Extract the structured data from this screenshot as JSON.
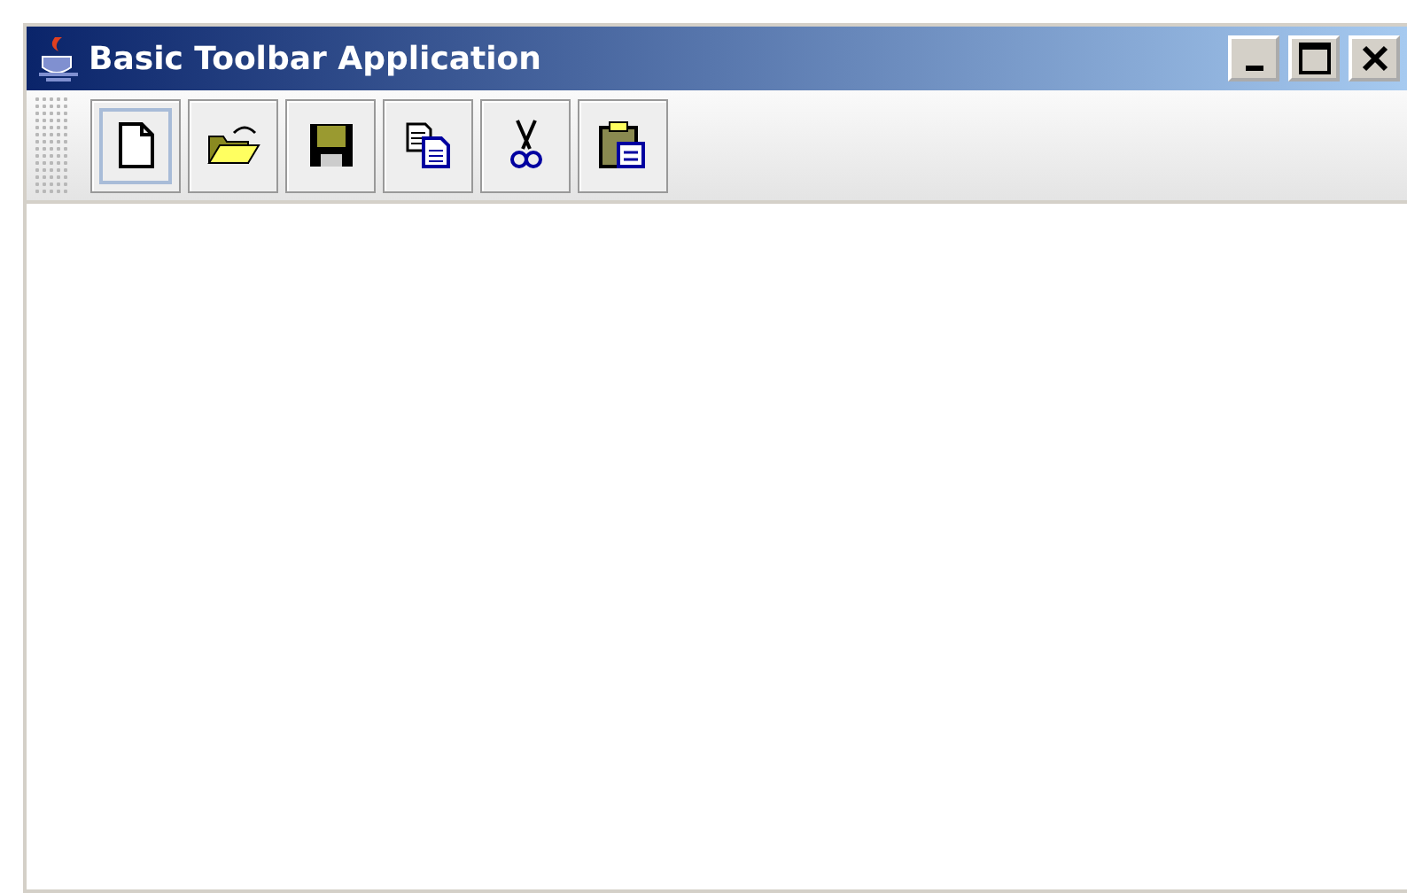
{
  "window": {
    "title": "Basic Toolbar Application"
  },
  "toolbar": {
    "buttons": [
      {
        "kind": "new",
        "focused": true
      },
      {
        "kind": "open",
        "focused": false
      },
      {
        "kind": "save",
        "focused": false
      },
      {
        "kind": "copy",
        "focused": false
      },
      {
        "kind": "cut",
        "focused": false
      },
      {
        "kind": "paste",
        "focused": false
      }
    ]
  }
}
